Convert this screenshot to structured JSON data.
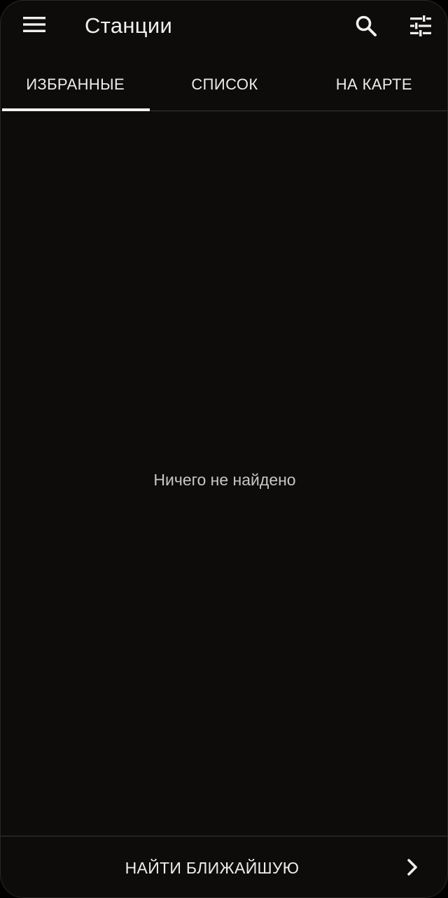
{
  "appbar": {
    "title": "Станции",
    "icons": {
      "menu": "menu-icon",
      "search": "search-icon",
      "filter": "tune-icon"
    }
  },
  "tabs": [
    {
      "label": "ИЗБРАННЫЕ",
      "selected": true
    },
    {
      "label": "СПИСОК",
      "selected": false
    },
    {
      "label": "НА КАРТЕ",
      "selected": false
    }
  ],
  "main": {
    "empty_text": "Ничего не найдено"
  },
  "bottom": {
    "action_label": "НАЙТИ БЛИЖАЙШУЮ",
    "icon": "chevron-right-icon"
  },
  "colors": {
    "background": "#0e0c0b",
    "text": "#f2f0ee",
    "muted_text": "#c9c6c3",
    "divider": "#3a3836",
    "indicator": "#f4f2f0"
  }
}
